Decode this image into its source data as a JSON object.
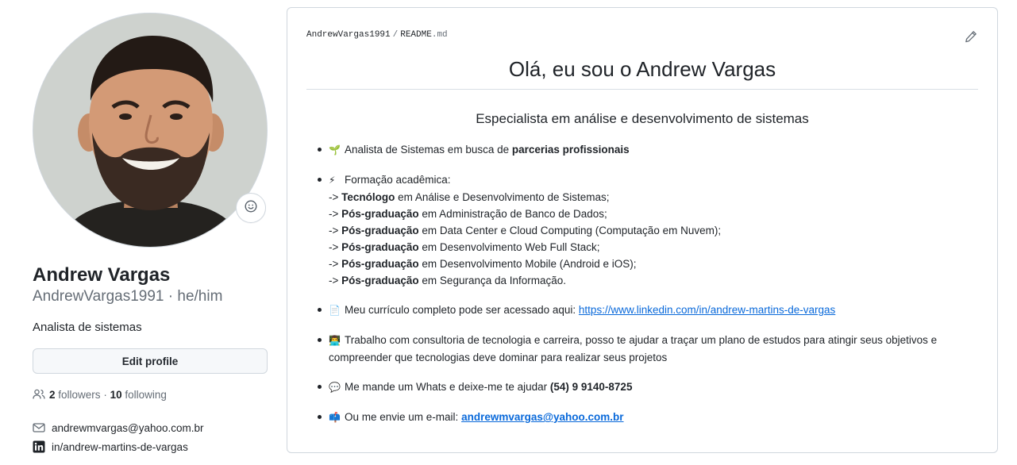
{
  "profile": {
    "name": "Andrew Vargas",
    "login": "AndrewVargas1991",
    "pronouns_sep": " · ",
    "pronouns": "he/him",
    "bio": "Analista de sistemas",
    "edit_button": "Edit profile",
    "followers_count": "2",
    "followers_label": "followers",
    "following_sep": " · ",
    "following_count": "10",
    "following_label": "following",
    "email": "andrewmvargas@yahoo.com.br",
    "linkedin": "in/andrew-martins-de-vargas",
    "icons": {
      "status": "smiley-icon",
      "followers": "people-icon",
      "email": "mail-icon",
      "linkedin": "linkedin-icon"
    }
  },
  "readme": {
    "breadcrumb": {
      "owner": "AndrewVargas1991",
      "sep": "/",
      "file": "README",
      "ext": ".md"
    },
    "title": "Olá, eu sou o Andrew Vargas",
    "subtitle": "Especialista em análise e desenvolvimento de sistemas",
    "items": [
      {
        "emoji": "🌱",
        "text": "Analista de Sistemas em busca de ",
        "bold": "parcerias profissionais"
      },
      {
        "emoji": "⚡",
        "text": "Formação acadêmica:",
        "lines": [
          {
            "prefix": "-> ",
            "bold": "Tecnólogo",
            "rest": " em Análise e Desenvolvimento de Sistemas;"
          },
          {
            "prefix": "-> ",
            "bold": "Pós-graduação",
            "rest": " em Administração de Banco de Dados;"
          },
          {
            "prefix": "-> ",
            "bold": "Pós-graduação",
            "rest": " em Data Center e Cloud Computing (Computação em Nuvem);"
          },
          {
            "prefix": "-> ",
            "bold": "Pós-graduação",
            "rest": " em Desenvolvimento Web Full Stack;"
          },
          {
            "prefix": "-> ",
            "bold": "Pós-graduação",
            "rest": " em Desenvolvimento Mobile (Android e iOS);"
          },
          {
            "prefix": "-> ",
            "bold": "Pós-graduação",
            "rest": " em Segurança da Informação."
          }
        ]
      },
      {
        "emoji": "📄",
        "text": "Meu currículo completo pode ser acessado aqui: ",
        "link": "https://www.linkedin.com/in/andrew-martins-de-vargas"
      },
      {
        "emoji": "👨‍💻",
        "text": "Trabalho com consultoria de tecnologia e carreira, posso te ajudar a traçar um plano de estudos para atingir seus objetivos e compreender que tecnologias deve dominar para realizar seus projetos"
      },
      {
        "emoji": "💬",
        "text": "Me mande um Whats e deixe-me te ajudar ",
        "bold": "(54) 9 9140-8725"
      },
      {
        "emoji": "📫",
        "text": "Ou me envie um e-mail: ",
        "link": "andrewmvargas@yahoo.com.br"
      }
    ],
    "icons": {
      "edit": "pencil-icon"
    }
  },
  "colors": {
    "link": "#0969da",
    "muted": "#656d76",
    "border": "#d0d7de",
    "text": "#1f2328"
  }
}
